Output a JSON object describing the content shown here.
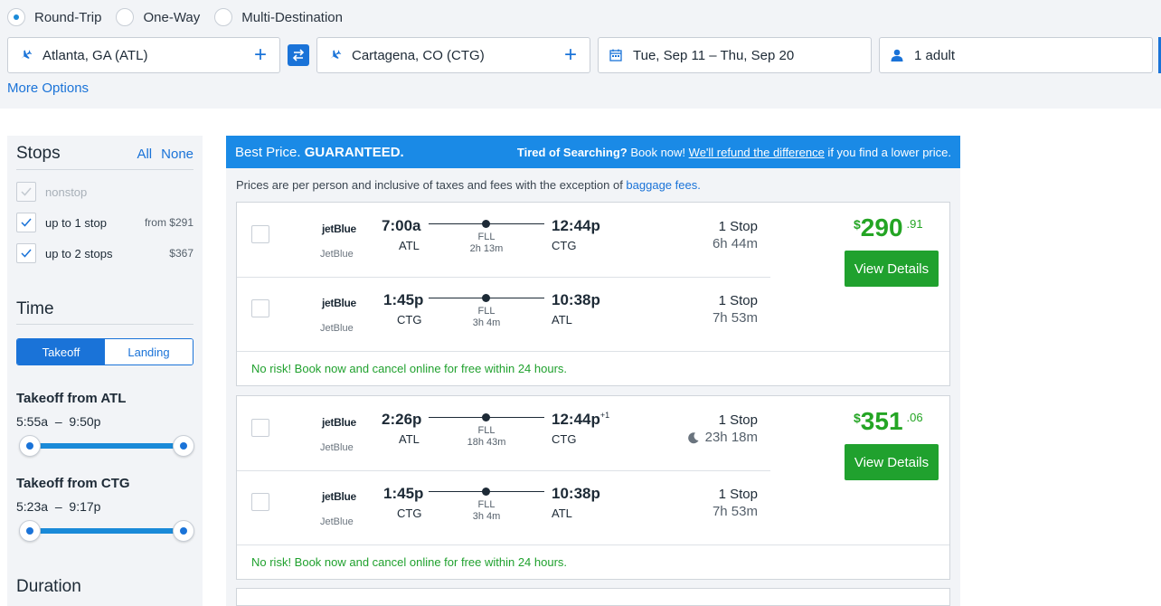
{
  "search": {
    "trip_types": [
      {
        "label": "Round-Trip",
        "selected": true
      },
      {
        "label": "One-Way",
        "selected": false
      },
      {
        "label": "Multi-Destination",
        "selected": false
      }
    ],
    "origin": "Atlanta, GA (ATL)",
    "destination": "Cartagena, CO (CTG)",
    "dates": "Tue, Sep 11 – Thu, Sep 20",
    "travelers": "1 adult",
    "more_options": "More Options",
    "accent_color": "#1a73d8"
  },
  "sidebar": {
    "stops_title": "Stops",
    "all_label": "All",
    "none_label": "None",
    "stops": [
      {
        "label": "nonstop",
        "price": "",
        "checked": true,
        "disabled": true
      },
      {
        "label": "up to 1 stop",
        "price": "from $291",
        "checked": true,
        "disabled": false
      },
      {
        "label": "up to 2 stops",
        "price": "$367",
        "checked": true,
        "disabled": false
      }
    ],
    "time_title": "Time",
    "takeoff_label": "Takeoff",
    "landing_label": "Landing",
    "takeoff_atl": {
      "title": "Takeoff from ATL",
      "min": "5:55a",
      "dash": "–",
      "max": "9:50p"
    },
    "takeoff_ctg": {
      "title": "Takeoff from CTG",
      "min": "5:23a",
      "dash": "–",
      "max": "9:17p"
    },
    "duration_title": "Duration"
  },
  "results": {
    "banner_left_prefix": "Best Price. ",
    "banner_left_bold": "GUARANTEED.",
    "banner_right_bold": "Tired of Searching?",
    "banner_right_mid": " Book now! ",
    "banner_right_link": "We'll refund the difference",
    "banner_right_suffix": " if you find a lower price.",
    "price_note": "Prices are per person and inclusive of taxes and fees with the exception of ",
    "price_note_link": "baggage fees.",
    "cards": [
      {
        "price_currency": "$",
        "price_dollars": "290",
        "price_cents": ".91",
        "view_label": "View Details",
        "no_risk": "No risk! Book now and cancel online for free within 24 hours.",
        "legs": [
          {
            "logo": "jetBlue",
            "airline": "JetBlue",
            "dep_time": "7:00a",
            "dep_code": "ATL",
            "via": "FLL",
            "duration_small": "2h 13m",
            "arr_time": "12:44p",
            "arr_plus": "",
            "arr_code": "CTG",
            "stops": "1 Stop",
            "duration": "6h 44m",
            "overnight": false
          },
          {
            "logo": "jetBlue",
            "airline": "JetBlue",
            "dep_time": "1:45p",
            "dep_code": "CTG",
            "via": "FLL",
            "duration_small": "3h 4m",
            "arr_time": "10:38p",
            "arr_plus": "",
            "arr_code": "ATL",
            "stops": "1 Stop",
            "duration": "7h 53m",
            "overnight": false
          }
        ]
      },
      {
        "price_currency": "$",
        "price_dollars": "351",
        "price_cents": ".06",
        "view_label": "View Details",
        "no_risk": "No risk! Book now and cancel online for free within 24 hours.",
        "legs": [
          {
            "logo": "jetBlue",
            "airline": "JetBlue",
            "dep_time": "2:26p",
            "dep_code": "ATL",
            "via": "FLL",
            "duration_small": "18h 43m",
            "arr_time": "12:44p",
            "arr_plus": "+1",
            "arr_code": "CTG",
            "stops": "1 Stop",
            "duration": "23h 18m",
            "overnight": true
          },
          {
            "logo": "jetBlue",
            "airline": "JetBlue",
            "dep_time": "1:45p",
            "dep_code": "CTG",
            "via": "FLL",
            "duration_small": "3h 4m",
            "arr_time": "10:38p",
            "arr_plus": "",
            "arr_code": "ATL",
            "stops": "1 Stop",
            "duration": "7h 53m",
            "overnight": false
          }
        ]
      }
    ]
  }
}
